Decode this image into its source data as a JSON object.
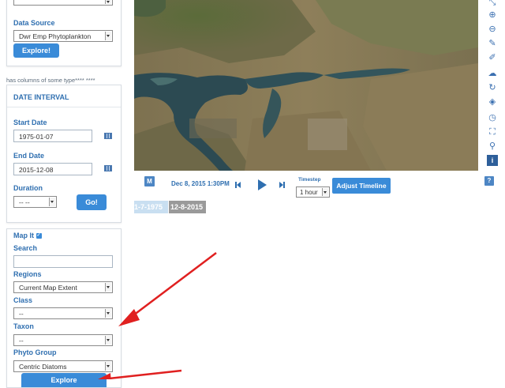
{
  "source_panel": {
    "data_source_label": "Data Source",
    "data_source_value": "Dwr Emp Phytoplankton",
    "explore_button": "Explore!"
  },
  "note_text": "has columns of some type**** ****",
  "date_panel": {
    "title": "DATE INTERVAL",
    "start_label": "Start Date",
    "start_value": "1975-01-07",
    "end_label": "End Date",
    "end_value": "2015-12-08",
    "duration_label": "Duration",
    "duration_value": "-- --",
    "go_button": "Go!"
  },
  "timeline": {
    "m_button": "M",
    "current_time": "Dec 8, 2015 1:30PM",
    "timestep_label": "Timestep",
    "timestep_value": "1 hour",
    "adjust_button": "Adjust Timeline",
    "help_button": "?",
    "range_start": "1-7-1975",
    "range_end": "12-8-2015"
  },
  "filter_panel": {
    "map_it_label": "Map It",
    "search_label": "Search",
    "search_value": "",
    "regions_label": "Regions",
    "regions_value": "Current Map Extent",
    "class_label": "Class",
    "class_value": "--",
    "taxon_label": "Taxon",
    "taxon_value": "--",
    "phyto_label": "Phyto Group",
    "phyto_value": "Centric Diatoms",
    "bottom_button": "Explore"
  },
  "map_tools": [
    "expand-icon",
    "zoom-in-icon",
    "zoom-out-icon",
    "pen-icon",
    "edit-icon",
    "cloud-upload-icon",
    "refresh-icon",
    "layers-icon",
    "clock-icon",
    "fullscreen-icon",
    "search-icon",
    "info-icon"
  ],
  "colors": {
    "accent": "#3a8bd8",
    "label_blue": "#2f6fb0",
    "arrow": "#e02020"
  }
}
